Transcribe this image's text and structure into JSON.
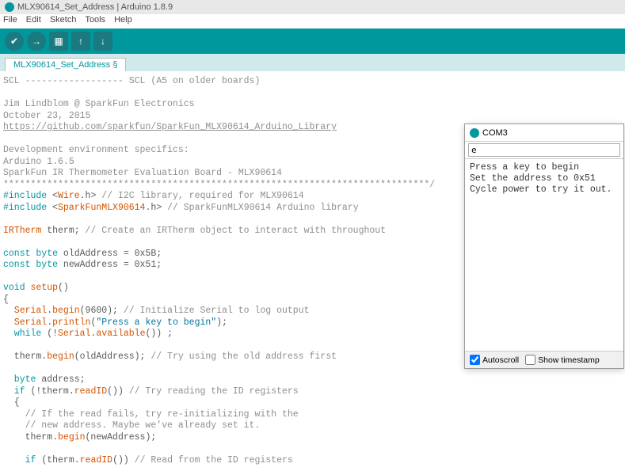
{
  "title": "MLX90614_Set_Address | Arduino 1.8.9",
  "menu": [
    "File",
    "Edit",
    "Sketch",
    "Tools",
    "Help"
  ],
  "toolbar_icons": {
    "verify": "✔",
    "upload": "→",
    "new": "▦",
    "open": "↑",
    "save": "↓"
  },
  "tab": "MLX90614_Set_Address §",
  "code_lines": [
    {
      "cls": "c-gray",
      "text": "SCL ------------------ SCL (A5 on older boards)"
    },
    {
      "cls": "",
      "text": ""
    },
    {
      "cls": "c-gray",
      "text": "Jim Lindblom @ SparkFun Electronics"
    },
    {
      "cls": "c-gray",
      "text": "October 23, 2015"
    },
    {
      "cls": "c-link",
      "text": "https://github.com/sparkfun/SparkFun_MLX90614_Arduino_Library"
    },
    {
      "cls": "",
      "text": ""
    },
    {
      "cls": "c-gray",
      "text": "Development environment specifics:"
    },
    {
      "cls": "c-gray",
      "text": "Arduino 1.6.5"
    },
    {
      "cls": "c-gray",
      "text": "SparkFun IR Thermometer Evaluation Board - MLX90614"
    },
    {
      "cls": "c-gray",
      "text": "******************************************************************************/"
    }
  ],
  "code_tokens": {
    "include1_a": "#include",
    "include1_b": "<",
    "include1_c": "Wire",
    "include1_d": ".h>",
    "include1_cmt": " // I2C library, required for MLX90614",
    "include2_a": "#include",
    "include2_b": "<",
    "include2_c": "SparkFunMLX90614",
    "include2_d": ".h>",
    "include2_cmt": " // SparkFunMLX90614 Arduino library",
    "irtherm": "IRTherm",
    "therm": " therm;",
    "therm_cmt": " // Create an IRTherm object to interact with throughout",
    "const1": "const byte",
    "old_var": " oldAddress = 0x5B;",
    "const2": "const byte",
    "new_var": " newAddress = 0x51;",
    "void": "void",
    "setup": " setup",
    "parens": "()",
    "lbrace": "{",
    "serial_begin_a": "  Serial",
    "serial_begin_b": ".",
    "serial_begin_c": "begin",
    "serial_begin_d": "(9600);",
    "serial_begin_cmt": " // Initialize Serial to log output",
    "serial_println_a": "  Serial",
    "serial_println_b": ".",
    "serial_println_c": "println",
    "serial_println_d": "(",
    "serial_println_str": "\"Press a key to begin\"",
    "serial_println_e": ");",
    "while_a": "  while",
    "while_b": " (!",
    "while_c": "Serial",
    "while_d": ".",
    "while_e": "available",
    "while_f": "()) ;",
    "therm_begin_a": "  therm.",
    "therm_begin_b": "begin",
    "therm_begin_c": "(oldAddress);",
    "therm_begin_cmt": " // Try using the old address first",
    "byte": "  byte",
    "addr_var": " address;",
    "if1_a": "  if",
    "if1_b": " (!therm.",
    "if1_c": "readID",
    "if1_d": "())",
    "if1_cmt": " // Try reading the ID registers",
    "lbrace2": "  {",
    "cmt_fail": "    // If the read fails, try re-initializing with the",
    "cmt_new": "    // new address. Maybe we've already set it.",
    "therm2_a": "    therm.",
    "therm2_b": "begin",
    "therm2_c": "(newAddress);",
    "if2_a": "    if",
    "if2_b": " (therm.",
    "if2_c": "readID",
    "if2_d": "())",
    "if2_cmt": " // Read from the ID registers"
  },
  "serial": {
    "port": "COM3",
    "input_value": "e",
    "output": "Press a key to begin\nSet the address to 0x51\nCycle power to try it out.",
    "autoscroll": "Autoscroll",
    "autoscroll_checked": true,
    "timestamp": "Show timestamp",
    "timestamp_checked": false
  }
}
